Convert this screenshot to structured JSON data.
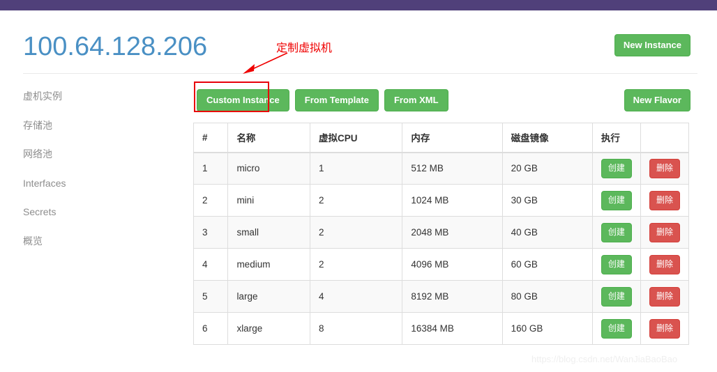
{
  "topbar": {
    "color": "#50407a"
  },
  "header": {
    "title": "100.64.128.206",
    "title_color": "#4a90c4",
    "new_instance_label": "New Instance"
  },
  "sidebar": {
    "items": [
      {
        "label": "虚机实例"
      },
      {
        "label": "存储池"
      },
      {
        "label": "网络池"
      },
      {
        "label": "Interfaces"
      },
      {
        "label": "Secrets"
      },
      {
        "label": "概览"
      }
    ]
  },
  "toolbar": {
    "custom_instance_label": "Custom Instance",
    "from_template_label": "From Template",
    "from_xml_label": "From XML",
    "new_flavor_label": "New Flavor"
  },
  "annotation": {
    "label": "定制虚拟机",
    "color": "#ef0000",
    "highlight_color": "#e8000a"
  },
  "table": {
    "headers": [
      "#",
      "名称",
      "虚拟CPU",
      "内存",
      "磁盘镜像",
      "执行",
      ""
    ],
    "rows": [
      {
        "idx": "1",
        "name": "micro",
        "vcpu": "1",
        "memory": "512 MB",
        "disk": "20 GB",
        "create": "创建",
        "delete": "删除"
      },
      {
        "idx": "2",
        "name": "mini",
        "vcpu": "2",
        "memory": "1024 MB",
        "disk": "30 GB",
        "create": "创建",
        "delete": "删除"
      },
      {
        "idx": "3",
        "name": "small",
        "vcpu": "2",
        "memory": "2048 MB",
        "disk": "40 GB",
        "create": "创建",
        "delete": "删除"
      },
      {
        "idx": "4",
        "name": "medium",
        "vcpu": "2",
        "memory": "4096 MB",
        "disk": "60 GB",
        "create": "创建",
        "delete": "删除"
      },
      {
        "idx": "5",
        "name": "large",
        "vcpu": "4",
        "memory": "8192 MB",
        "disk": "80 GB",
        "create": "创建",
        "delete": "删除"
      },
      {
        "idx": "6",
        "name": "xlarge",
        "vcpu": "8",
        "memory": "16384 MB",
        "disk": "160 GB",
        "create": "创建",
        "delete": "删除"
      }
    ]
  },
  "watermark": {
    "text": "https://blog.csdn.net/WanJiaBaoBao"
  },
  "colors": {
    "green": "#5cb85c",
    "red": "#d9534f",
    "purple": "#50407a",
    "blue": "#4a90c4"
  }
}
